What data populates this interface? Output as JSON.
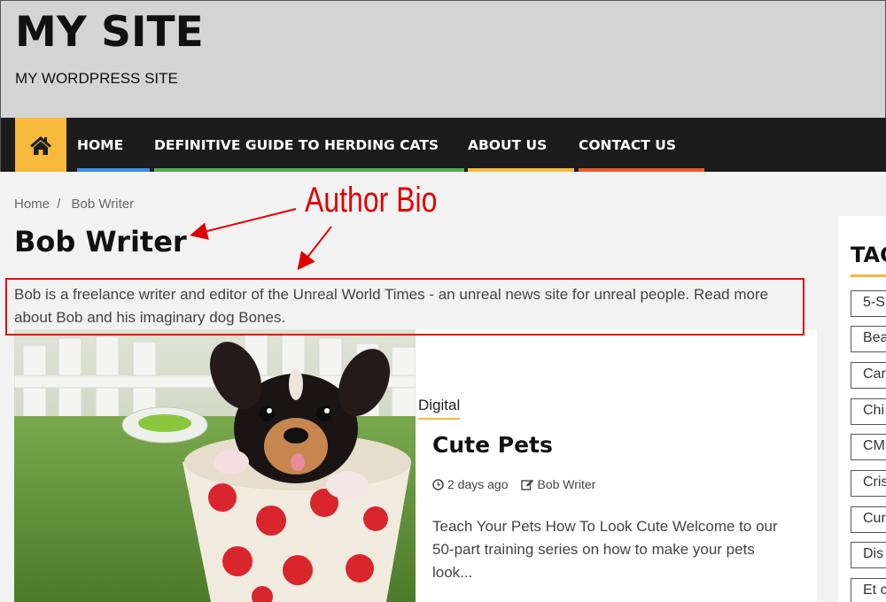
{
  "site": {
    "title": "MY SITE",
    "tagline": "MY WORDPRESS SITE"
  },
  "nav": {
    "home_icon": "home-icon",
    "items": [
      {
        "label": "HOME",
        "color": "#3b8fe8"
      },
      {
        "label": "DEFINITIVE GUIDE TO HERDING CATS",
        "color": "#4caf50"
      },
      {
        "label": "ABOUT US",
        "color": "#f6b93b"
      },
      {
        "label": "CONTACT US",
        "color": "#f05a28"
      }
    ]
  },
  "breadcrumb": {
    "home": "Home",
    "separator": "/",
    "current": "Bob Writer"
  },
  "author": {
    "name": "Bob Writer",
    "bio": "Bob is a freelance writer and editor of the Unreal World Times - an unreal news site for unreal people. Read more about Bob and his imaginary dog Bones."
  },
  "annotation": {
    "label": "Author Bio",
    "color": "#e00000"
  },
  "post": {
    "category": "Digital",
    "title": "Cute Pets",
    "date": "2 days ago",
    "author": "Bob Writer",
    "excerpt": "Teach Your Pets How To Look Cute Welcome to our 50-part training series on how to make your pets look...",
    "image_icon": "puppy-in-cup-image"
  },
  "sidebar": {
    "title": "TAGS",
    "tags": [
      "5-S",
      "Bea",
      "Car",
      "Chi",
      "CMS",
      "Cris",
      "Cur",
      "Dis",
      "Et c"
    ]
  },
  "colors": {
    "accent": "#f6b93b",
    "nav_bg": "#1c1c1c",
    "header_bg": "#d4d4d4"
  }
}
